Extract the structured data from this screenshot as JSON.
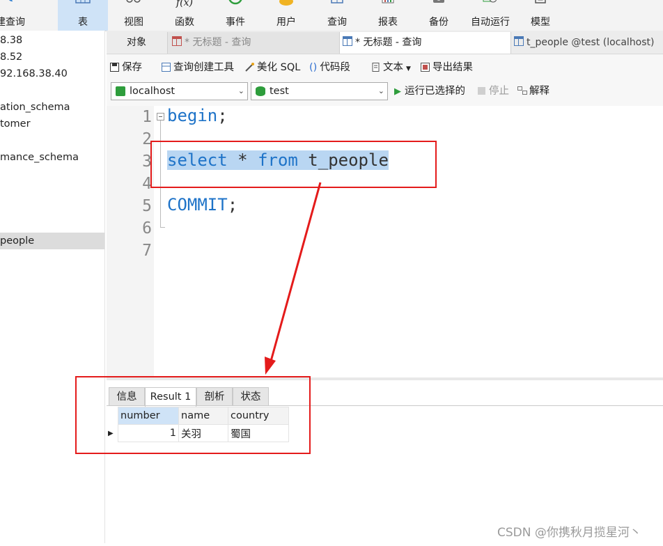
{
  "toolbar": {
    "items": [
      {
        "label": "建查询",
        "icon": "new-query-icon"
      },
      {
        "label": "表",
        "icon": "table-icon",
        "active": true
      },
      {
        "label": "视图",
        "icon": "view-icon"
      },
      {
        "label": "函数",
        "icon": "function-icon"
      },
      {
        "label": "事件",
        "icon": "event-icon"
      },
      {
        "label": "用户",
        "icon": "user-icon"
      },
      {
        "label": "查询",
        "icon": "query-icon"
      },
      {
        "label": "报表",
        "icon": "report-icon"
      },
      {
        "label": "备份",
        "icon": "backup-icon"
      },
      {
        "label": "自动运行",
        "icon": "auto-run-icon"
      },
      {
        "label": "模型",
        "icon": "model-icon"
      }
    ],
    "function_glyph": "f(x)"
  },
  "tree": {
    "items": [
      {
        "label": "8.38"
      },
      {
        "label": "8.52"
      },
      {
        "label": "92.168.38.40"
      },
      {
        "label": "ation_schema"
      },
      {
        "label": "tomer"
      },
      {
        "label": "mance_schema"
      },
      {
        "label": "people",
        "selected": true
      }
    ]
  },
  "tabs": [
    {
      "label": "对象"
    },
    {
      "label": "* 无标题 - 查询"
    },
    {
      "label": "* 无标题 - 查询",
      "active": true
    },
    {
      "label": "t_people @test (localhost)"
    }
  ],
  "query_toolbar": {
    "save": "保存",
    "query_builder": "查询创建工具",
    "beautify_sql": "美化 SQL",
    "code_snippet": "代码段",
    "code_snippet_glyph": "()",
    "text": "文本",
    "export": "导出结果",
    "connection": "localhost",
    "database": "test",
    "run_selected": "运行已选择的",
    "stop": "停止",
    "explain": "解释"
  },
  "editor": {
    "line_numbers": [
      "1",
      "2",
      "3",
      "4",
      "5",
      "6",
      "7"
    ],
    "lines": {
      "l1_kw": "begin",
      "l1_rest": ";",
      "l3_a": "select",
      "l3_b": " * ",
      "l3_c": "from",
      "l3_d": " t_people",
      "l5_kw": "COMMIT",
      "l5_rest": ";"
    }
  },
  "results": {
    "tabs": [
      {
        "label": "信息"
      },
      {
        "label": "Result 1",
        "active": true
      },
      {
        "label": "剖析"
      },
      {
        "label": "状态"
      }
    ],
    "columns": [
      "number",
      "name",
      "country"
    ],
    "rows": [
      {
        "number": "1",
        "name": "关羽",
        "country": "蜀国"
      }
    ]
  },
  "watermark": "CSDN @你携秋月揽星河丶",
  "colors": {
    "annotation_red": "#e41b1b",
    "keyword_blue": "#1e73c8",
    "selection": "#b9d6f2",
    "active_blue": "#cfe3f7"
  }
}
